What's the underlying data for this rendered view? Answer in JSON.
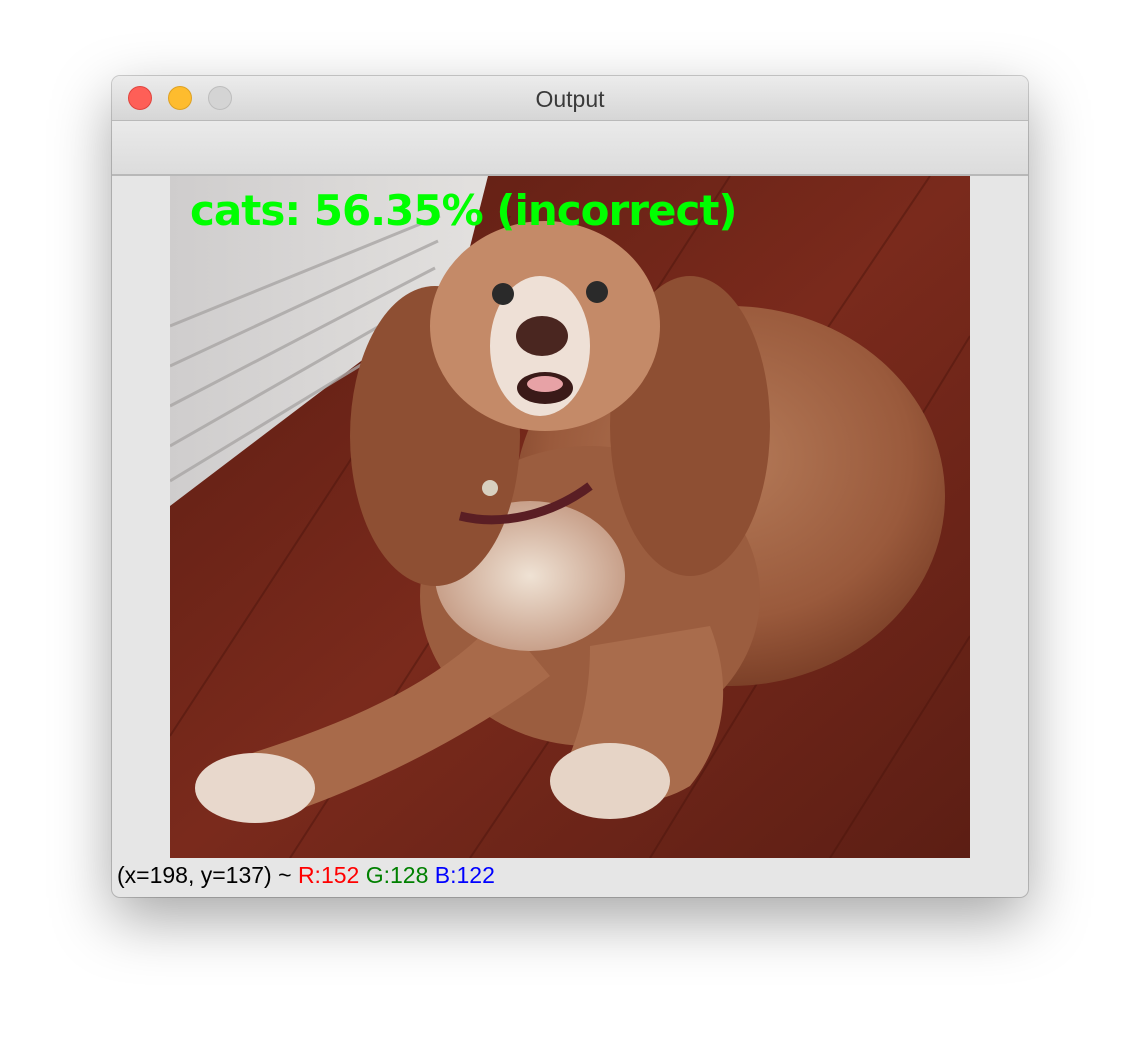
{
  "window": {
    "title": "Output"
  },
  "image": {
    "alt": "dog",
    "prediction_label": "cats: 56.35% (incorrect)",
    "label_color": "#00ff00"
  },
  "statusbar": {
    "coords": "(x=198, y=137) ~",
    "r": "R:152",
    "g": "G:128",
    "b": "B:122",
    "r_color": "#ff0000",
    "g_color": "#008000",
    "b_color": "#0000ff"
  }
}
